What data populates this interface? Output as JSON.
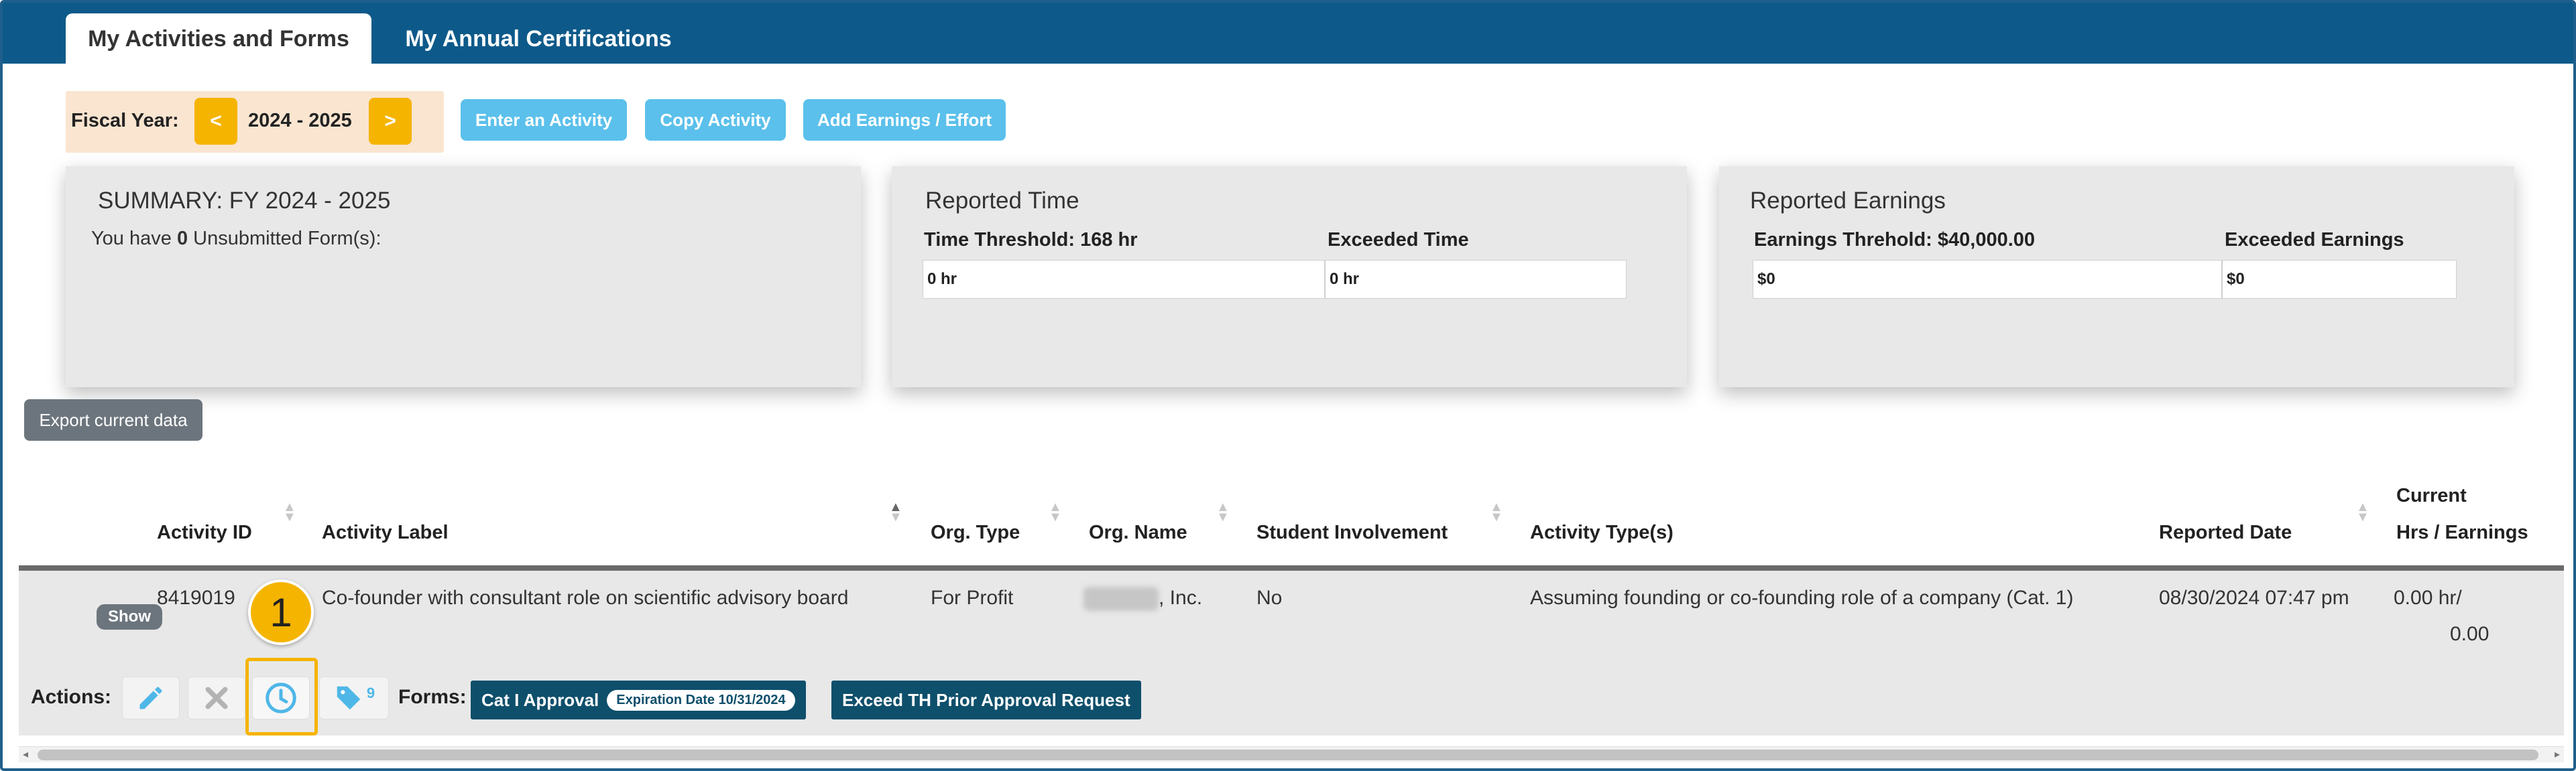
{
  "tabs": {
    "active": "My Activities and Forms",
    "inactive": "My Annual Certifications"
  },
  "fiscal_year": {
    "label": "Fiscal Year:",
    "year": "2024 - 2025",
    "prev": "<",
    "next": ">"
  },
  "toolbar": {
    "enter": "Enter an Activity",
    "copy": "Copy Activity",
    "add": "Add Earnings / Effort"
  },
  "summary": {
    "title": "SUMMARY: FY 2024 - 2025",
    "prefix": "You have ",
    "count": "0",
    "suffix": " Unsubmitted Form(s):"
  },
  "time": {
    "title": "Reported Time",
    "threshold_label": "Time Threshold: 168 hr",
    "threshold_value": "0 hr",
    "exceeded_label": "Exceeded Time",
    "exceeded_value": "0 hr"
  },
  "earnings": {
    "title": "Reported Earnings",
    "threshold_label": "Earnings Threhold: $40,000.00",
    "threshold_value": "$0",
    "exceeded_label": "Exceeded Earnings",
    "exceeded_value": "$0"
  },
  "export_label": "Export current data",
  "table": {
    "headers": {
      "id": "Activity ID",
      "label": "Activity Label",
      "org_type": "Org. Type",
      "org_name": "Org. Name",
      "student": "Student Involvement",
      "types": "Activity Type(s)",
      "date": "Reported Date",
      "current1": "Current",
      "current2": "Hrs / Earnings"
    },
    "row": {
      "show": "Show",
      "id": "8419019",
      "label": "Co-founder with consultant role on scientific advisory board",
      "org_type": "For Profit",
      "org_name": ", Inc.",
      "student": "No",
      "types": "Assuming founding or co-founding role of a company (Cat. 1)",
      "date": "08/30/2024 07:47 pm",
      "current1": "0.00 hr/",
      "current2": "0.00"
    },
    "actions_label": "Actions:",
    "tag_count": "9",
    "forms_label": "Forms:",
    "form1": "Cat I Approval",
    "form1_expiry": "Expiration Date 10/31/2024",
    "form2": "Exceed TH Prior Approval Request"
  },
  "callout_number": "1",
  "icons": [
    "pencil-icon",
    "close-icon",
    "clock-icon",
    "tag-icon",
    "sort-icon"
  ]
}
